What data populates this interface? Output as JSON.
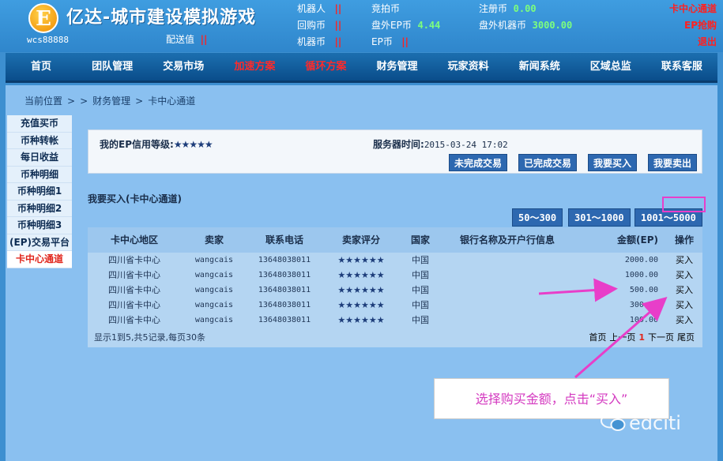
{
  "header": {
    "logo_letter": "E",
    "title": "亿达-城市建设模拟游戏",
    "user_id": "wcs88888",
    "distribution_label": "配送值",
    "distribution_value": "||",
    "stats": [
      {
        "label": "机器人",
        "value": "||",
        "type": "red"
      },
      {
        "label": "回购币",
        "value": "||",
        "type": "red"
      },
      {
        "label": "机器币",
        "value": "||",
        "type": "red"
      },
      {
        "label": "竞拍币",
        "value": "",
        "type": "red"
      },
      {
        "label": "盘外EP币",
        "value": "4.44",
        "type": "green"
      },
      {
        "label": "EP币",
        "value": "||",
        "type": "red"
      },
      {
        "label": "注册币",
        "value": "0.00",
        "type": "green"
      },
      {
        "label": "盘外机器币",
        "value": "3000.00",
        "type": "green"
      }
    ],
    "links": [
      "卡中心通道",
      "EP抢购",
      "退出"
    ]
  },
  "nav": {
    "items": [
      {
        "label": "首页",
        "hot": false
      },
      {
        "label": "团队管理",
        "hot": false
      },
      {
        "label": "交易市场",
        "hot": false
      },
      {
        "label": "加速方案",
        "hot": true
      },
      {
        "label": "循环方案",
        "hot": true
      },
      {
        "label": "财务管理",
        "hot": false
      },
      {
        "label": "玩家资料",
        "hot": false
      },
      {
        "label": "新闻系统",
        "hot": false
      },
      {
        "label": "区域总监",
        "hot": false
      },
      {
        "label": "联系客服",
        "hot": false
      }
    ]
  },
  "breadcrumb": [
    "当前位置",
    ">",
    ">",
    "财务管理",
    ">",
    "卡中心通道"
  ],
  "sidebar": {
    "items": [
      "充值买币",
      "币种转帐",
      "每日收益",
      "币种明细",
      "币种明细1",
      "币种明细2",
      "币种明细3",
      "(EP)交易平台",
      "卡中心通道"
    ],
    "active_index": 8
  },
  "panel": {
    "credit_label": "我的EP信用等级:",
    "credit_stars": "★★★★★",
    "server_time_label": "服务器时间:",
    "server_time_value": "2015-03-24 17:02",
    "buttons": [
      "未完成交易",
      "已完成交易",
      "我要买入",
      "我要卖出"
    ]
  },
  "section_title": "我要买入(卡中心通道)",
  "ranges": [
    "50～300",
    "301～1000",
    "1001～5000"
  ],
  "table": {
    "headers": [
      "卡中心地区",
      "卖家",
      "联系电话",
      "卖家评分",
      "国家",
      "银行名称及开户行信息",
      "金额(EP)",
      "操作"
    ],
    "rows": [
      [
        "四川省卡中心",
        "wangcais",
        "13648038011",
        "★★★★★★",
        "中国",
        "",
        "2000.00",
        "买入"
      ],
      [
        "四川省卡中心",
        "wangcais",
        "13648038011",
        "★★★★★★",
        "中国",
        "",
        "1000.00",
        "买入"
      ],
      [
        "四川省卡中心",
        "wangcais",
        "13648038011",
        "★★★★★★",
        "中国",
        "",
        "500.00",
        "买入"
      ],
      [
        "四川省卡中心",
        "wangcais",
        "13648038011",
        "★★★★★★",
        "中国",
        "",
        "300.00",
        "买入"
      ],
      [
        "四川省卡中心",
        "wangcais",
        "13648038011",
        "★★★★★★",
        "中国",
        "",
        "100.00",
        "买入"
      ]
    ],
    "summary": "显示1到5,共5记录,每页30条",
    "pager": {
      "first": "首页",
      "prev": "上一页",
      "current": "1",
      "next": "下一页",
      "last": "尾页"
    }
  },
  "annotation": {
    "note": "选择购买金额，点击“买入”",
    "color": "#e83ec9"
  },
  "watermark": "edciti"
}
